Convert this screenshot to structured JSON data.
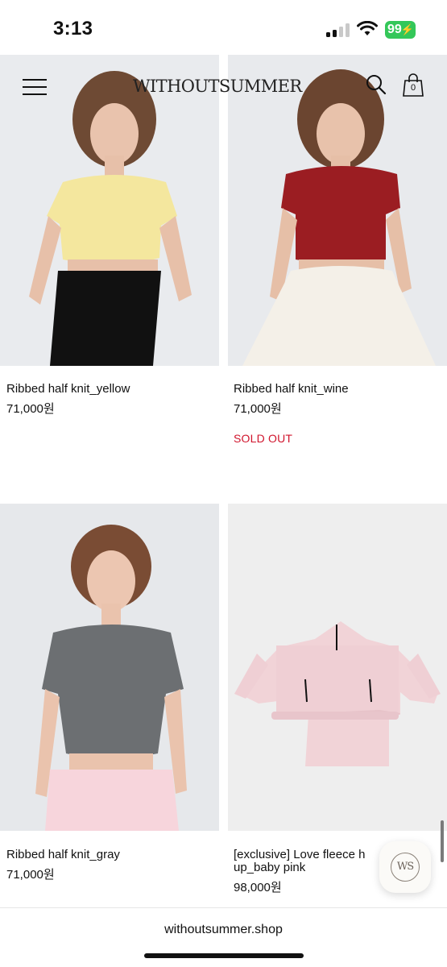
{
  "status_bar": {
    "time": "3:13",
    "battery": "99",
    "icons": [
      "signal-icon",
      "wifi-icon",
      "battery-icon"
    ]
  },
  "header": {
    "logo": "WITHOUTSUMMER",
    "menu_icon": "hamburger-icon",
    "search_icon": "search-icon",
    "bag_icon": "shopping-bag-icon",
    "bag_count": "0"
  },
  "products": [
    {
      "name": "Ribbed half knit_yellow",
      "price": "71,000원",
      "status": ""
    },
    {
      "name": "Ribbed half knit_wine",
      "price": "71,000원",
      "status": "SOLD OUT"
    },
    {
      "name": "Ribbed half knit_gray",
      "price": "71,000원",
      "status": ""
    },
    {
      "name": "[exclusive] Love fleece h",
      "name_line2": "up_baby pink",
      "price": "98,000원",
      "status": ""
    }
  ],
  "badge": {
    "text": "WS"
  },
  "browser": {
    "url": "withoutsummer.shop"
  },
  "colors": {
    "sold_out": "#d0142c",
    "battery": "#34c759"
  }
}
